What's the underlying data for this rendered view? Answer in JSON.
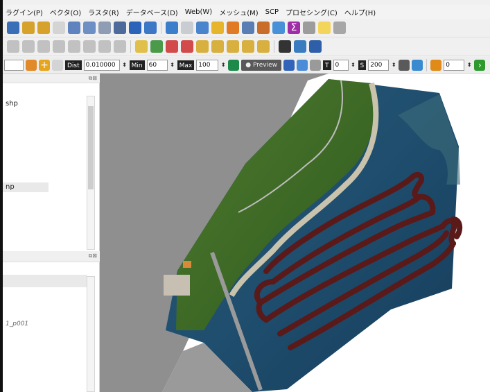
{
  "menu": [
    "ラグイン(P)",
    "ベクタ(O)",
    "ラスタ(R)",
    "データベース(D)",
    "Web(W)",
    "メッシュ(M)",
    "SCP",
    "プロセシング(C)",
    "ヘルプ(H)"
  ],
  "scp_toolbar": {
    "dist_label": "Dist",
    "dist_value": "0.010000",
    "min_label": "Min",
    "min_value": "60",
    "max_label": "Max",
    "max_value": "100",
    "preview_label": "Preview",
    "t_label": "T",
    "t_value": "0",
    "s_label": "S",
    "s_value": "200",
    "last_value": "0"
  },
  "layers_panel": {
    "item1": "shp",
    "item2": "np"
  },
  "bottom_panel": {
    "item": "1_p001"
  }
}
